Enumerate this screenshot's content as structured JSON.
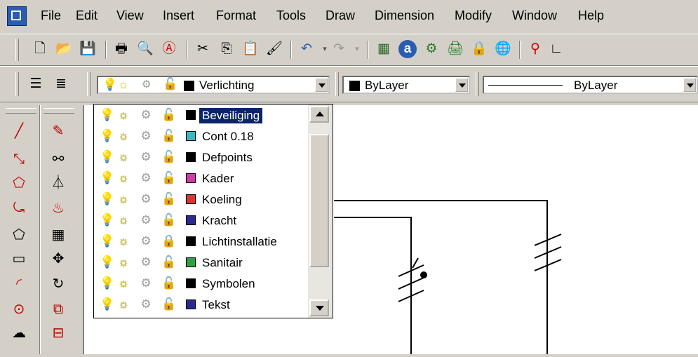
{
  "menu": [
    "File",
    "Edit",
    "View",
    "Insert",
    "Format",
    "Tools",
    "Draw",
    "Dimension",
    "Modify",
    "Window",
    "Help"
  ],
  "layer_combo": {
    "value": "Verlichting"
  },
  "color_combo": {
    "value": "ByLayer",
    "swatch": "#000000"
  },
  "linetype_combo": {
    "value": "ByLayer"
  },
  "layers": [
    {
      "name": "Beveiliging",
      "color": "#000000",
      "bulb": "on",
      "lock": "unlocked",
      "selected": true
    },
    {
      "name": "Cont 0.18",
      "color": "#3cb8c0",
      "bulb": "on",
      "lock": "unlocked",
      "selected": false
    },
    {
      "name": "Defpoints",
      "color": "#000000",
      "bulb": "on",
      "lock": "unlocked",
      "selected": false
    },
    {
      "name": "Kader",
      "color": "#d03aa8",
      "bulb": "on",
      "lock": "unlocked",
      "selected": false
    },
    {
      "name": "Koeling",
      "color": "#e03030",
      "bulb": "on",
      "lock": "unlocked",
      "selected": false
    },
    {
      "name": "Kracht",
      "color": "#2a2a90",
      "bulb": "off",
      "lock": "unlocked",
      "selected": false
    },
    {
      "name": "Lichtinstallatie",
      "color": "#000000",
      "bulb": "on",
      "lock": "locked",
      "selected": false
    },
    {
      "name": "Sanitair",
      "color": "#30a040",
      "bulb": "on",
      "lock": "unlocked",
      "selected": false
    },
    {
      "name": "Symbolen",
      "color": "#000000",
      "bulb": "on",
      "lock": "unlocked",
      "selected": false
    },
    {
      "name": "Tekst",
      "color": "#2a2a90",
      "bulb": "on",
      "lock": "unlocked",
      "selected": false
    }
  ],
  "colors": {
    "bulb_on": "#f5e000",
    "bulb_off": "#3a7ab0",
    "selection": "#0a246a",
    "sun": "#f0e000"
  }
}
